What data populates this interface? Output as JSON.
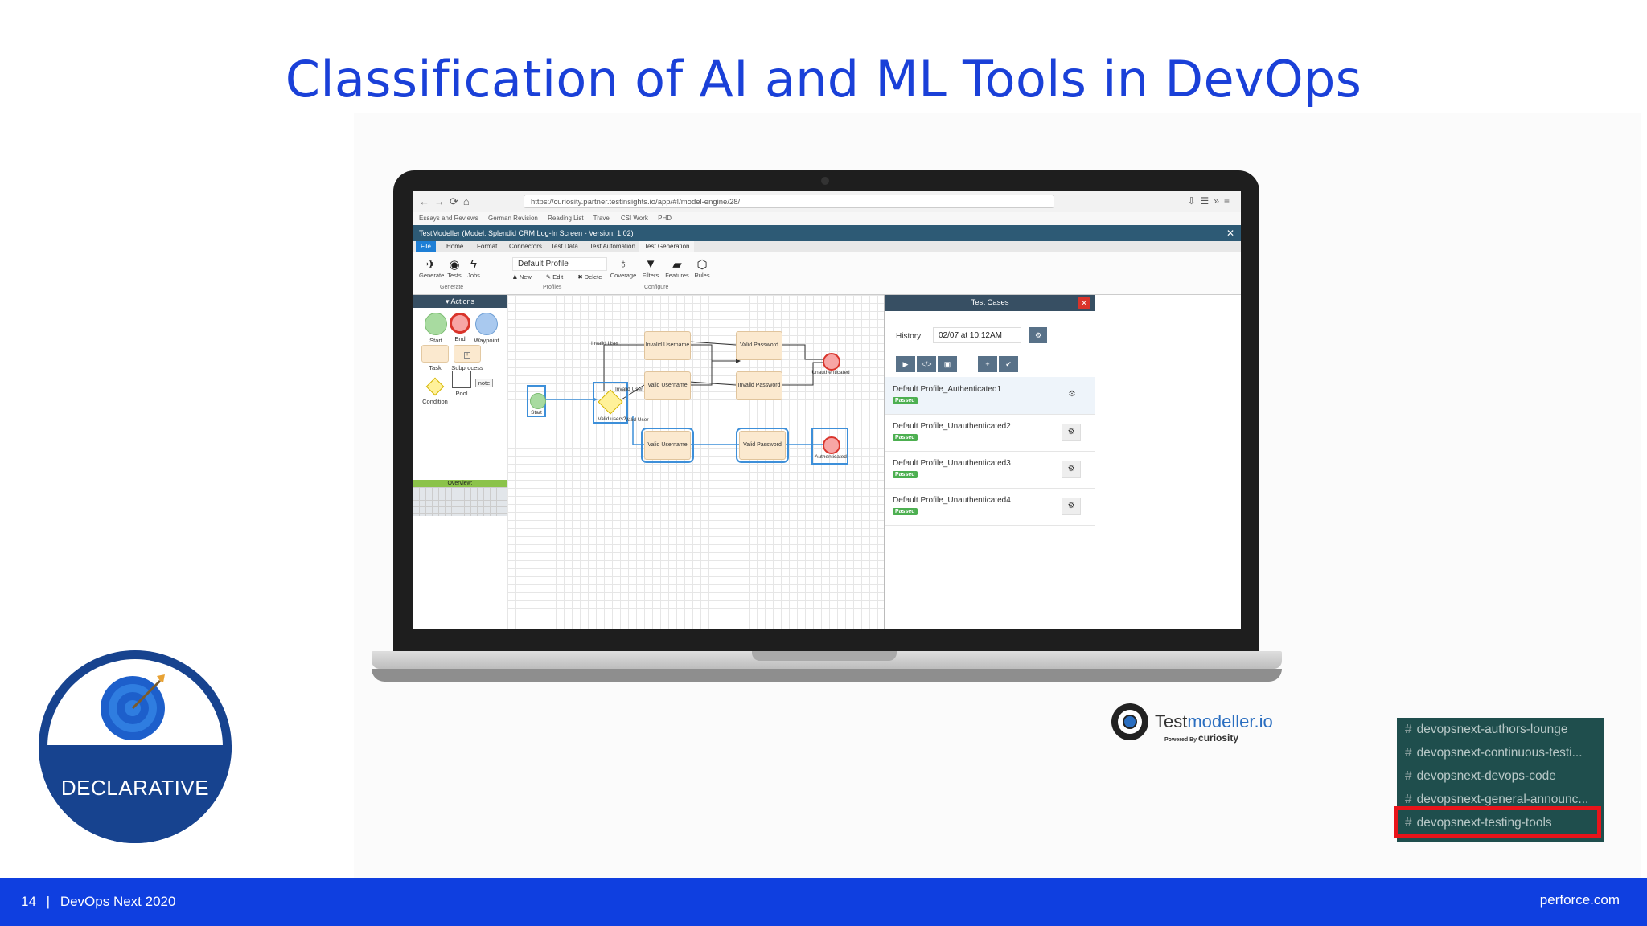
{
  "slide": {
    "title": "Classification of AI and ML Tools in DevOps",
    "page_number": "14",
    "separator": "|",
    "event": "DevOps Next 2020",
    "website": "perforce.com"
  },
  "browser": {
    "url": "https://curiosity.partner.testinsights.io/app/#!/model-engine/28/",
    "bookmarks": [
      "Essays and Reviews",
      "German Revision",
      "Reading List",
      "Travel",
      "CSI Work",
      "PHD"
    ]
  },
  "app": {
    "title": "TestModeller (Model: Splendid CRM Log-In Screen - Version: 1.02)",
    "menu_tabs": [
      "File",
      "Home",
      "Format",
      "Connectors",
      "Test Data",
      "Test Automation",
      "Test Generation"
    ],
    "ribbon": {
      "generate": "Generate",
      "tests": "Tests",
      "jobs": "Jobs",
      "profile": "Default Profile",
      "new": "New",
      "edit": "Edit",
      "delete": "Delete",
      "coverage": "Coverage",
      "filters": "Filters",
      "features": "Features",
      "rules": "Rules",
      "group_generate": "Generate",
      "group_profiles": "Profiles",
      "group_configure": "Configure"
    },
    "actions": {
      "header": "Actions",
      "start": "Start",
      "end": "End",
      "waypoint": "Waypoint",
      "task": "Task",
      "subprocess": "Subprocess",
      "condition": "Condition",
      "pool": "Pool",
      "note": "note",
      "overview": "Overview:"
    },
    "flow": {
      "start": "Start",
      "invalid_user_1": "Invalid User",
      "invalid_username": "Invalid Username",
      "valid_password_top": "Valid Password",
      "valid_username_mid": "Valid Username",
      "invalid_password": "Invalid Password",
      "invalid_user_2": "Invalid User",
      "valid_users": "Valid users?",
      "valid_user": "Valid User",
      "valid_username_bottom": "Valid Username",
      "valid_password_bottom": "Valid Password",
      "unauthenticated": "Unauthenticated",
      "authenticated": "Authenticated"
    },
    "test_cases": {
      "header": "Test Cases",
      "history_label": "History:",
      "history_value": "02/07 at 10:12AM",
      "items": [
        {
          "name": "Default Profile_Authenticated1",
          "status": "Passed"
        },
        {
          "name": "Default Profile_Unauthenticated2",
          "status": "Passed"
        },
        {
          "name": "Default Profile_Unauthenticated3",
          "status": "Passed"
        },
        {
          "name": "Default Profile_Unauthenticated4",
          "status": "Passed"
        }
      ]
    }
  },
  "logo": {
    "name_part1": "Test",
    "name_part2": "modeller.io",
    "powered_by": "Powered By",
    "company": "curiosity"
  },
  "badge": {
    "label": "DECLARATIVE"
  },
  "slack": {
    "channels": [
      "devopsnext-authors-lounge",
      "devopsnext-continuous-testi...",
      "devopsnext-devops-code",
      "devopsnext-general-announc...",
      "devopsnext-testing-tools"
    ],
    "highlighted_index": 4
  },
  "colors": {
    "title": "#1a40d8",
    "footer": "#0f3fe0",
    "badge": "#17438f",
    "slack_bg": "#1f4e4d",
    "highlight": "#e8141a"
  }
}
